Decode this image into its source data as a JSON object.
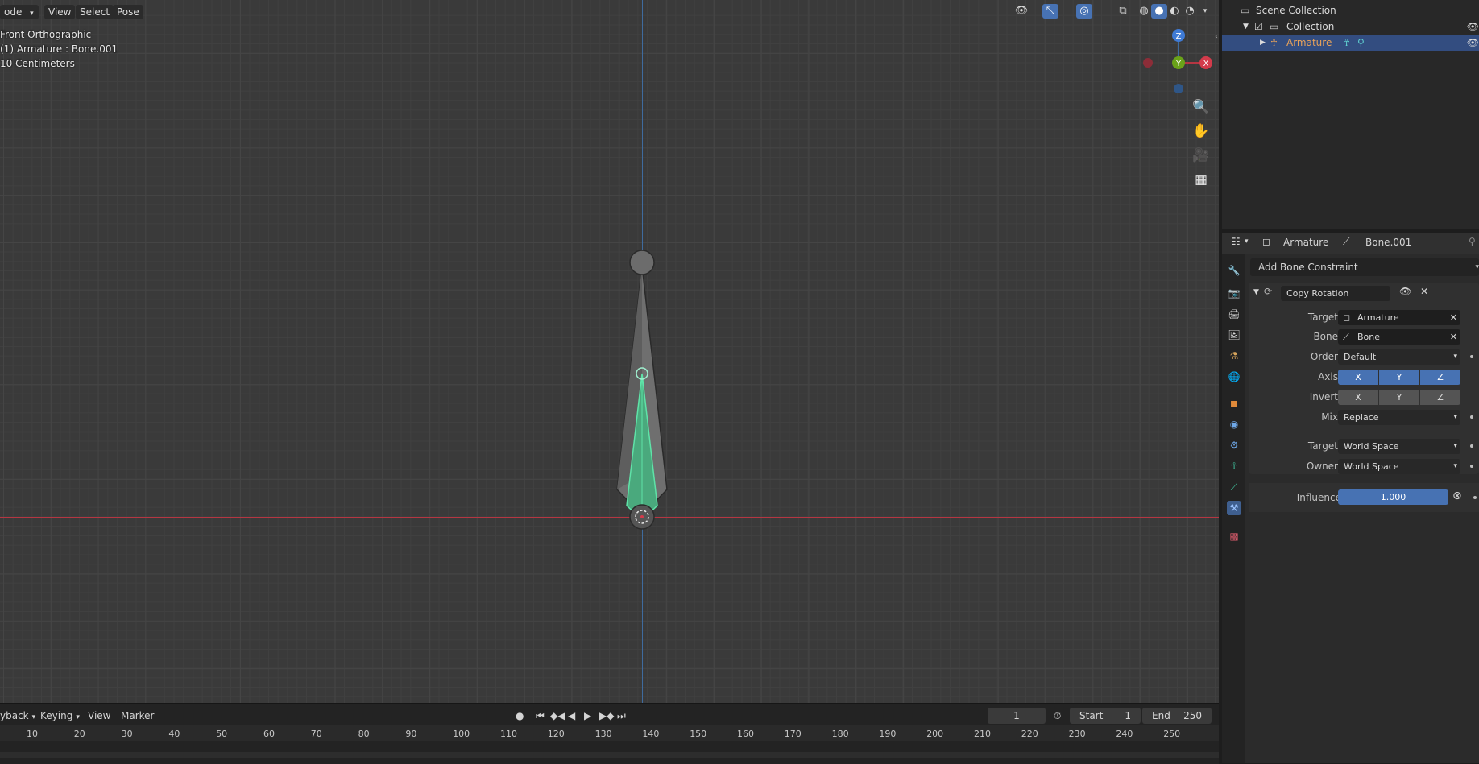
{
  "viewport": {
    "header": {
      "mode_label": "ode",
      "menu_items": [
        "View",
        "Select",
        "Pose"
      ]
    },
    "overlay": {
      "view_name": "Front Orthographic",
      "object_info": "(1) Armature : Bone.001",
      "scale": "10 Centimeters"
    },
    "gizmo": {
      "z": "Z",
      "y": "Y",
      "x": "X"
    }
  },
  "timeline": {
    "menu_items": [
      "yback",
      "Keying",
      "View",
      "Marker"
    ],
    "current_frame": "1",
    "start_label": "Start",
    "start_value": "1",
    "end_label": "End",
    "end_value": "250",
    "ticks": [
      "10",
      "20",
      "30",
      "40",
      "50",
      "60",
      "70",
      "80",
      "90",
      "100",
      "110",
      "120",
      "130",
      "140",
      "150",
      "160",
      "170",
      "180",
      "190",
      "200",
      "210",
      "220",
      "230",
      "240",
      "250"
    ]
  },
  "outliner": {
    "scene_collection": "Scene Collection",
    "collection": "Collection",
    "armature": "Armature"
  },
  "properties": {
    "breadcrumb_object": "Armature",
    "breadcrumb_bone": "Bone.001",
    "add_constraint": "Add Bone Constraint",
    "constraint": {
      "name": "Copy Rotation",
      "target_label": "Target",
      "target_value": "Armature",
      "bone_label": "Bone",
      "bone_value": "Bone",
      "order_label": "Order",
      "order_value": "Default",
      "axis_label": "Axis",
      "invert_label": "Invert",
      "axis_x": "X",
      "axis_y": "Y",
      "axis_z": "Z",
      "mix_label": "Mix",
      "mix_value": "Replace",
      "target_space_label": "Target",
      "target_space_value": "World Space",
      "owner_space_label": "Owner",
      "owner_space_value": "World Space",
      "influence_label": "Influence",
      "influence_value": "1.000"
    }
  },
  "colors": {
    "accent_blue": "#4772b3",
    "selection_row": "#334d80",
    "bone_green": "#5fe3a8",
    "axis_red": "#b53642",
    "axis_blue": "#3f6b9e"
  }
}
